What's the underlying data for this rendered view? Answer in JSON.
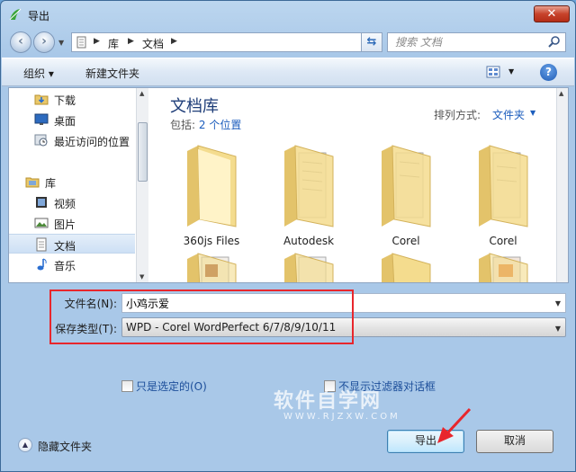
{
  "window": {
    "title": "导出"
  },
  "address": {
    "crumbs": [
      "库",
      "文档"
    ]
  },
  "search": {
    "placeholder": "搜索 文档"
  },
  "toolbar": {
    "organize_label": "组织 ▾",
    "new_folder_label": "新建文件夹"
  },
  "nav": {
    "items": [
      {
        "label": "下载",
        "icon": "download-folder-icon"
      },
      {
        "label": "桌面",
        "icon": "desktop-icon"
      },
      {
        "label": "最近访问的位置",
        "icon": "recent-places-icon"
      },
      {
        "label": "库",
        "icon": "libraries-icon"
      },
      {
        "label": "视频",
        "icon": "video-library-icon"
      },
      {
        "label": "图片",
        "icon": "pictures-library-icon"
      },
      {
        "label": "文档",
        "icon": "documents-library-icon",
        "selected": true
      },
      {
        "label": "音乐",
        "icon": "music-library-icon"
      }
    ]
  },
  "library": {
    "title": "文档库",
    "includes_label": "包括:",
    "includes_link": "2 个位置",
    "arrange_label": "排列方式:",
    "arrange_value": "文件夹"
  },
  "folders": [
    {
      "name": "360js Files"
    },
    {
      "name": "Autodesk"
    },
    {
      "name": "Corel"
    },
    {
      "name": "Corel"
    }
  ],
  "form": {
    "filename_label": "文件名(N):",
    "filename_value": "小鸡示爱",
    "filetype_label": "保存类型(T):",
    "filetype_value": "WPD - Corel WordPerfect 6/7/8/9/10/11",
    "only_selected_label": "只是选定的(O)",
    "no_filter_dialog_label": "不显示过滤器对话框"
  },
  "watermark": {
    "text": "软件自学网",
    "sub": "WWW.RJZXW.COM"
  },
  "footer": {
    "hide_folders_label": "隐藏文件夹",
    "export_label": "导出",
    "cancel_label": "取消"
  },
  "colors": {
    "accent": "#1c5dbd",
    "highlight": "#e8262c"
  }
}
